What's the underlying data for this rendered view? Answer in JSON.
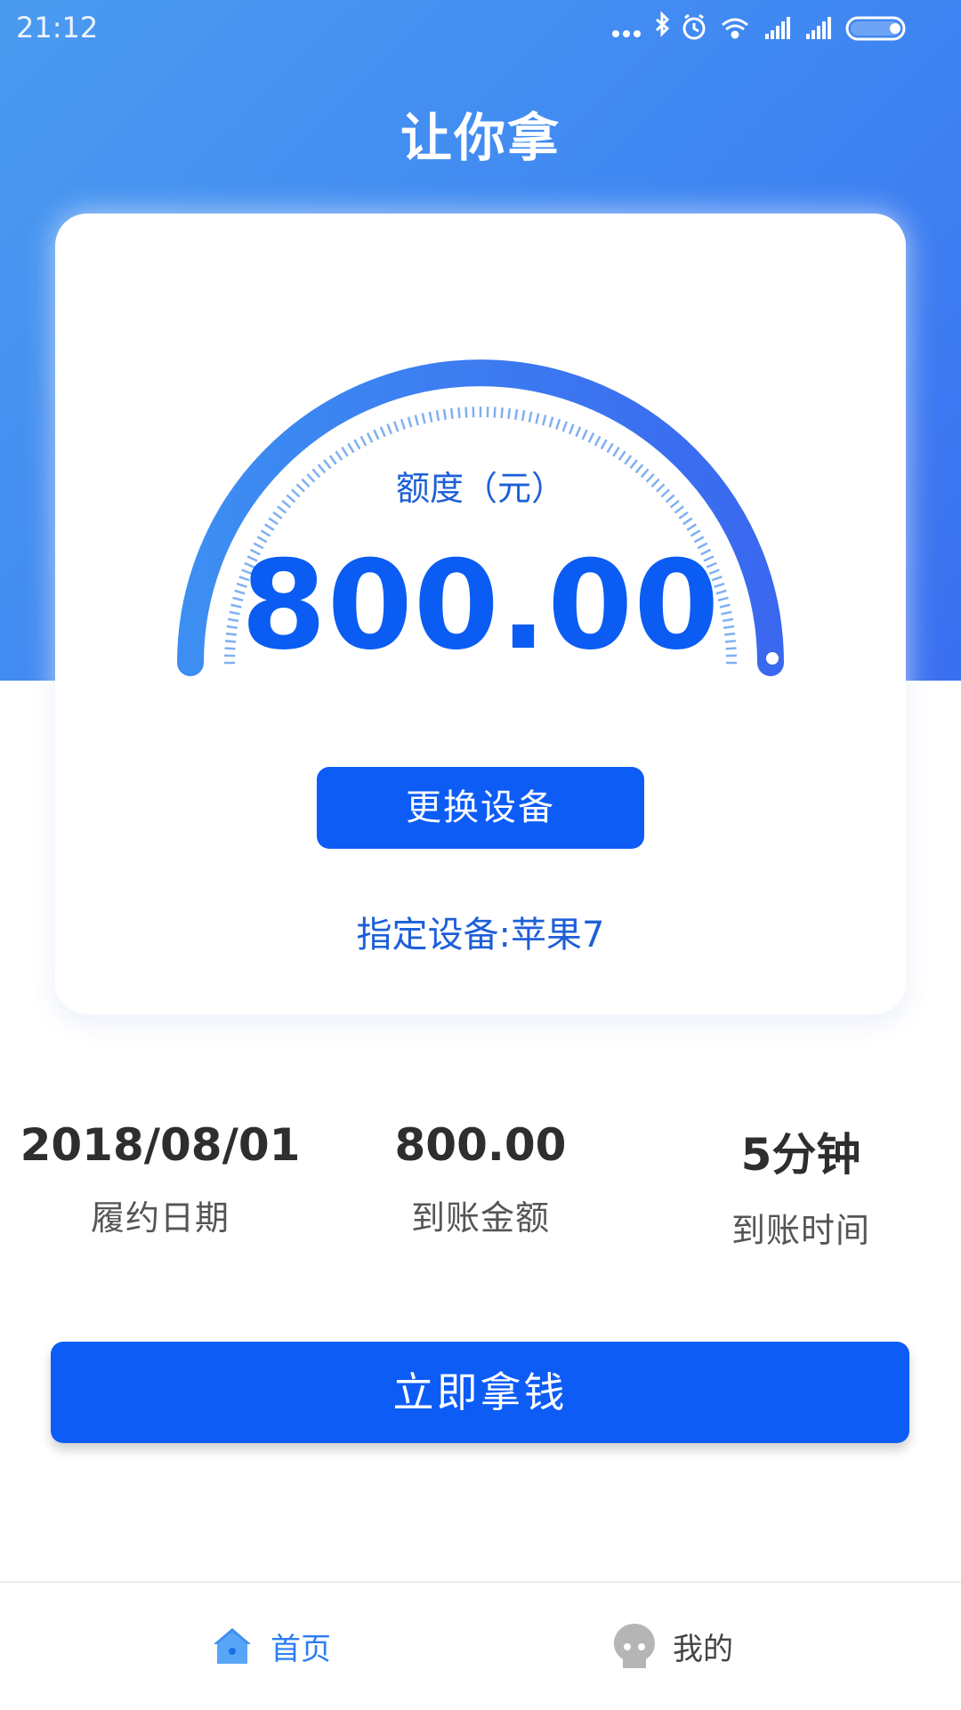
{
  "status_bar": {
    "time": "21:12",
    "icons": [
      "more-dots-icon",
      "bluetooth-icon",
      "alarm-icon",
      "wifi-icon",
      "signal-icon",
      "signal-icon",
      "battery-icon"
    ]
  },
  "app": {
    "title": "让你拿"
  },
  "quota": {
    "label": "额度（元）",
    "value": "800.00",
    "gauge_level": 1.0
  },
  "change_device_button": "更换设备",
  "device_info": "指定设备:苹果7",
  "stats": [
    {
      "value": "2018/08/01",
      "label": "履约日期"
    },
    {
      "value": "800.00",
      "label": "到账金额"
    },
    {
      "value": "5分钟",
      "label": "到账时间"
    }
  ],
  "cta_button": "立即拿钱",
  "tabbar": {
    "items": [
      {
        "label": "首页",
        "icon": "home-icon",
        "active": true
      },
      {
        "label": "我的",
        "icon": "user-avatar-icon",
        "active": false
      }
    ]
  },
  "colors": {
    "primary": "#0d5cf6",
    "header_gradient_start": "#4a9bf0",
    "header_gradient_end": "#3a6ff0",
    "accent_text": "#1d5fd8",
    "active_tab": "#2c7ef0"
  }
}
